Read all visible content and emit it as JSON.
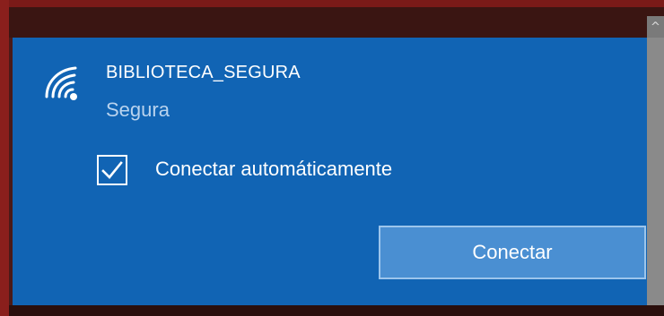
{
  "network": {
    "ssid": "BIBLIOTECA_SEGURA",
    "security": "Segura",
    "icon": "wifi-signal-icon"
  },
  "options": {
    "auto_connect_label": "Conectar automáticamente",
    "auto_connect_checked": true
  },
  "actions": {
    "connect_label": "Conectar"
  },
  "scrollbar": {
    "up_arrow_glyph": "^"
  },
  "colors": {
    "panel_background": "#1164b4",
    "secondary_text": "#b9d3ee",
    "button_background": "#4a8fd2",
    "button_border": "#9cc5ec",
    "window_border": "#8a1f1c"
  }
}
